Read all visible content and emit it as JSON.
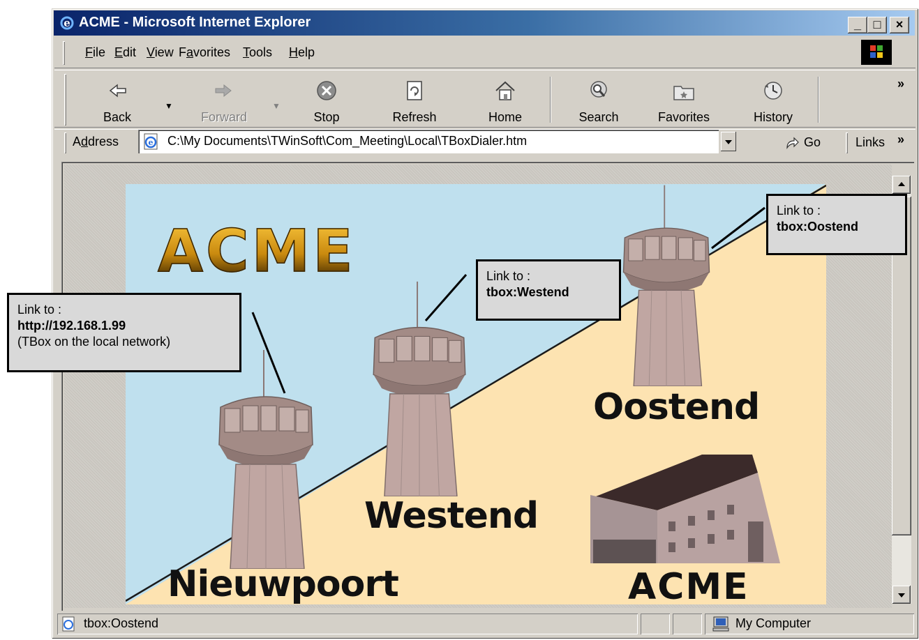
{
  "window": {
    "title": "ACME - Microsoft Internet Explorer",
    "controls": {
      "minimize": "_",
      "maximize": "□",
      "close": "×"
    }
  },
  "menu": {
    "items": [
      {
        "label": "File",
        "hotkey": "F"
      },
      {
        "label": "Edit",
        "hotkey": "E"
      },
      {
        "label": "View",
        "hotkey": "V"
      },
      {
        "label": "Favorites",
        "hotkey": "a"
      },
      {
        "label": "Tools",
        "hotkey": "T"
      },
      {
        "label": "Help",
        "hotkey": "H"
      }
    ]
  },
  "toolbar": {
    "back": "Back",
    "forward": "Forward",
    "stop": "Stop",
    "refresh": "Refresh",
    "home": "Home",
    "search": "Search",
    "favorites": "Favorites",
    "history": "History",
    "more": "»"
  },
  "address": {
    "label": "Address",
    "url": "C:\\My Documents\\TWinSoft\\Com_Meeting\\Local\\TBoxDialer.htm",
    "go": "Go",
    "links": "Links",
    "links_more": "»"
  },
  "page": {
    "logo_top": "ACME",
    "logo_bottom": "ACME",
    "towers": {
      "nieuwpoort": "Nieuwpoort",
      "westend": "Westend",
      "oostend": "Oostend"
    },
    "colors": {
      "sky": "#bfe0ee",
      "ground": "#fde3b1",
      "tower": "#b39a95",
      "logo": "#d79a17"
    }
  },
  "callouts": {
    "nieuwpoort": {
      "line1": "Link to :",
      "line2": "http://192.168.1.99",
      "line3": "(TBox on the local network)"
    },
    "westend": {
      "line1": "Link to :",
      "line2": "tbox:Westend"
    },
    "oostend": {
      "line1": "Link to :",
      "line2": "tbox:Oostend"
    }
  },
  "status": {
    "text": "tbox:Oostend",
    "zone": "My Computer"
  }
}
